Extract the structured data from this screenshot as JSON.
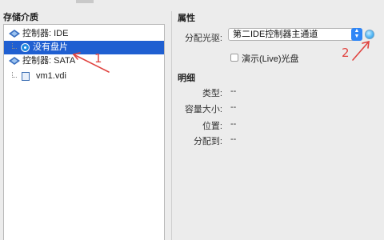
{
  "storage": {
    "title": "存储介质",
    "tree": [
      {
        "label": "控制器: IDE",
        "type": "controller"
      },
      {
        "label": "没有盘片",
        "type": "optical",
        "selected": true
      },
      {
        "label": "控制器: SATA",
        "type": "controller"
      },
      {
        "label": "vm1.vdi",
        "type": "hard-disk"
      }
    ]
  },
  "attributes": {
    "title": "属性",
    "optical_drive_label": "分配光驱:",
    "optical_drive_value": "第二IDE控制器主通道",
    "live_cd_label": "演示(Live)光盘"
  },
  "details": {
    "title": "明细",
    "rows": [
      {
        "label": "类型:",
        "value": "--"
      },
      {
        "label": "容量大小:",
        "value": "--"
      },
      {
        "label": "位置:",
        "value": "--"
      },
      {
        "label": "分配到:",
        "value": "--"
      }
    ]
  },
  "annotations": {
    "marker_1": "1",
    "marker_2": "2",
    "color": "#e0433f"
  },
  "colors": {
    "selection": "#1f5fd1",
    "accent": "#2f86f6"
  }
}
